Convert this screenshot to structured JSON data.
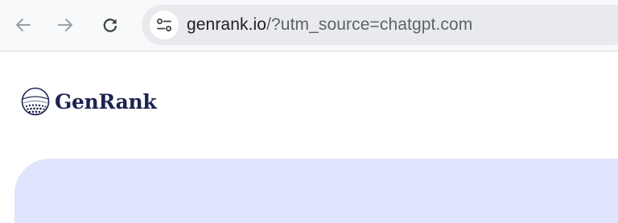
{
  "browser": {
    "back_icon": "arrow-left-icon",
    "forward_icon": "arrow-right-icon",
    "reload_icon": "reload-icon",
    "site_info_icon": "tune-icon",
    "url": {
      "host": "genrank.io",
      "rest": "/?utm_source=chatgpt.com"
    }
  },
  "page": {
    "logo": {
      "mark_icon": "globe-dots-icon",
      "text": "GenRank"
    },
    "colors": {
      "brand_navy": "#1d2350",
      "hero_background": "#e1e4fd"
    }
  }
}
